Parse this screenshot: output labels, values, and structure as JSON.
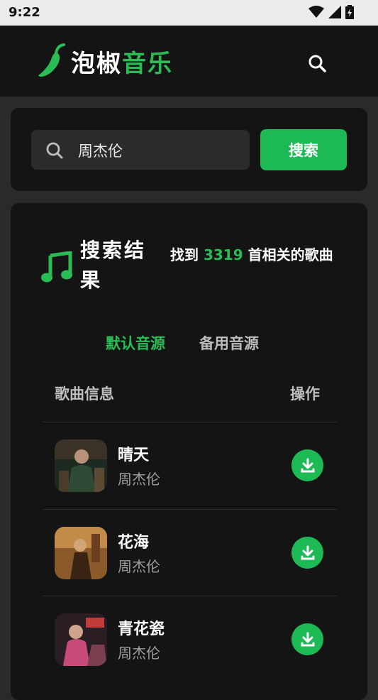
{
  "status_bar": {
    "time": "9:22"
  },
  "header": {
    "title_white": "泡椒",
    "title_green": "音乐"
  },
  "search": {
    "query": "周杰伦",
    "button_label": "搜索"
  },
  "results": {
    "title": "搜索结果",
    "found_prefix": "找到 ",
    "found_count": "3319",
    "found_suffix": " 首相关的歌曲",
    "tabs": [
      {
        "label": "默认音源",
        "active": true
      },
      {
        "label": "备用音源",
        "active": false
      }
    ],
    "columns": {
      "info": "歌曲信息",
      "action": "操作"
    },
    "songs": [
      {
        "title": "晴天",
        "artist": "周杰伦"
      },
      {
        "title": "花海",
        "artist": "周杰伦"
      },
      {
        "title": "青花瓷",
        "artist": "周杰伦"
      }
    ]
  },
  "colors": {
    "accent": "#1db954",
    "background": "#2a2a2a",
    "card": "#141414"
  }
}
